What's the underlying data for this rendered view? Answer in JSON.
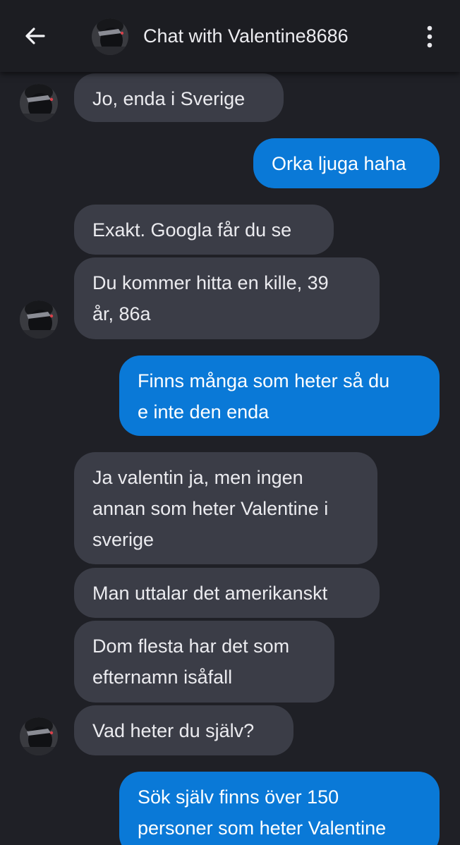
{
  "header": {
    "back_icon": "arrow-left-icon",
    "title": "Chat with Valentine8686",
    "menu_icon": "more-vertical-icon"
  },
  "theme": {
    "background": "#1f2026",
    "header_background": "#1c1d22",
    "incoming_bubble": "#3b3d47",
    "outgoing_bubble": "#0a79d7",
    "text": "#ebebef"
  },
  "messages": [
    {
      "direction": "incoming",
      "text": "Jo, enda i Sverige"
    },
    {
      "direction": "outgoing",
      "text": "Orka ljuga haha"
    },
    {
      "direction": "incoming",
      "text": "Exakt. Googla får du se"
    },
    {
      "direction": "incoming",
      "text": "Du kommer hitta en kille, 39\når, 86a"
    },
    {
      "direction": "outgoing",
      "text": "Finns många som heter så du\ne inte den enda"
    },
    {
      "direction": "incoming",
      "text": "Ja valentin ja, men ingen\nannan som heter Valentine i\nsverige"
    },
    {
      "direction": "incoming",
      "text": "Man uttalar det amerikanskt"
    },
    {
      "direction": "incoming",
      "text": "Dom flesta har det som\nefternamn isåfall"
    },
    {
      "direction": "incoming",
      "text": "Vad heter du själv?"
    },
    {
      "direction": "outgoing",
      "text": "Sök själv finns över 150\npersoner som heter Valentine"
    }
  ]
}
